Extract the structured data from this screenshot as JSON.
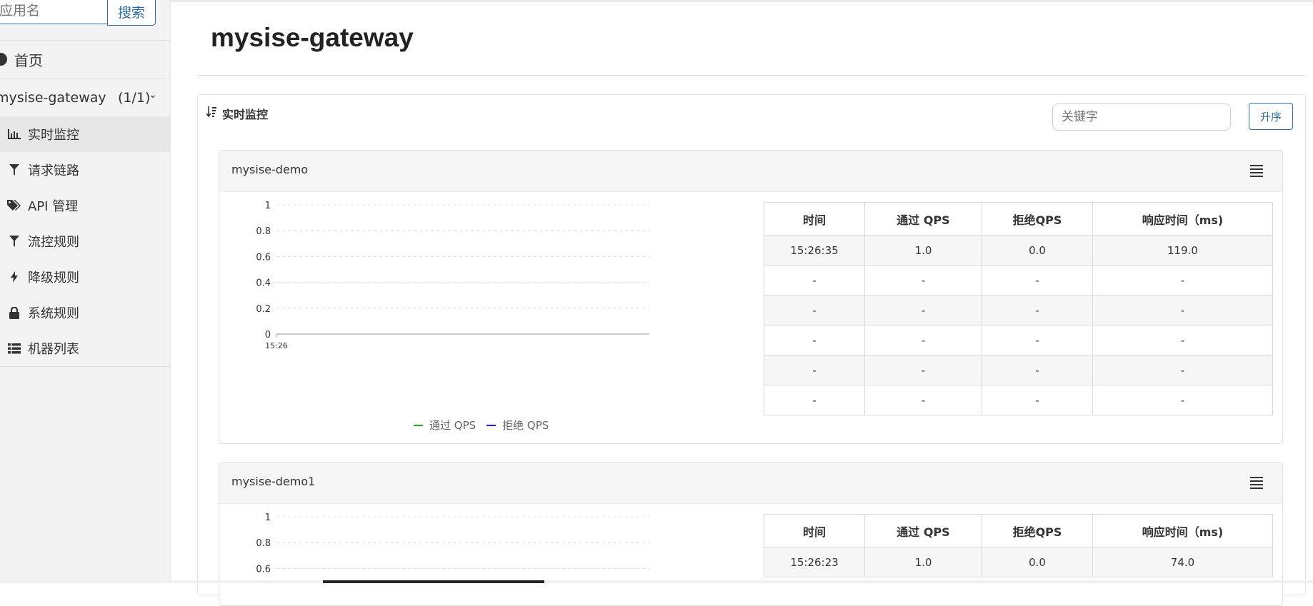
{
  "sidebar": {
    "search_placeholder": "应用名",
    "search_button": "搜索",
    "home_label": "首页",
    "app": {
      "name": "mysise-gateway",
      "count": "(1/1)"
    },
    "items": [
      {
        "label": "实时监控",
        "icon": "bar-chart-icon",
        "active": true
      },
      {
        "label": "请求链路",
        "icon": "filter-icon"
      },
      {
        "label": "API 管理",
        "icon": "tags-icon"
      },
      {
        "label": "流控规则",
        "icon": "filter-icon"
      },
      {
        "label": "降级规则",
        "icon": "flash-icon"
      },
      {
        "label": "系统规则",
        "icon": "lock-icon"
      },
      {
        "label": "机器列表",
        "icon": "list-icon"
      }
    ]
  },
  "main": {
    "title": "mysise-gateway",
    "panel_title": "实时监控",
    "keyword_placeholder": "关键字",
    "sort_button": "升序"
  },
  "table_headers": [
    "时间",
    "通过 QPS",
    "拒绝QPS",
    "响应时间（ms)"
  ],
  "cards": [
    {
      "title": "mysise-demo",
      "rows": [
        [
          "15:26:35",
          "1.0",
          "0.0",
          "119.0"
        ],
        [
          "-",
          "-",
          "-",
          "-"
        ],
        [
          "-",
          "-",
          "-",
          "-"
        ],
        [
          "-",
          "-",
          "-",
          "-"
        ],
        [
          "-",
          "-",
          "-",
          "-"
        ],
        [
          "-",
          "-",
          "-",
          "-"
        ]
      ]
    },
    {
      "title": "mysise-demo1",
      "rows": [
        [
          "15:26:23",
          "1.0",
          "0.0",
          "74.0"
        ]
      ]
    }
  ],
  "chart_data": [
    {
      "type": "line",
      "x": [
        "15:26"
      ],
      "series": [
        {
          "name": "通过 QPS",
          "values": [],
          "color": "#2ca02c"
        },
        {
          "name": "拒绝 QPS",
          "values": [],
          "color": "#1f1fc8"
        }
      ],
      "ylim": [
        0,
        1
      ],
      "yticks": [
        "1",
        "0.8",
        "0.6",
        "0.4",
        "0.2",
        "0"
      ],
      "xticks": [
        "15:26"
      ],
      "grid": true,
      "legend": "bottom"
    },
    {
      "type": "line",
      "x": [],
      "series": [
        {
          "name": "通过 QPS",
          "values": [],
          "color": "#2ca02c"
        },
        {
          "name": "拒绝 QPS",
          "values": [],
          "color": "#1f1fc8"
        }
      ],
      "ylim": [
        0,
        1
      ],
      "yticks": [
        "1",
        "0.8",
        "0.6"
      ],
      "grid": true
    }
  ],
  "colors": {
    "accent": "#2e6da4",
    "pass": "#2ca02c",
    "block": "#1f1fc8"
  }
}
